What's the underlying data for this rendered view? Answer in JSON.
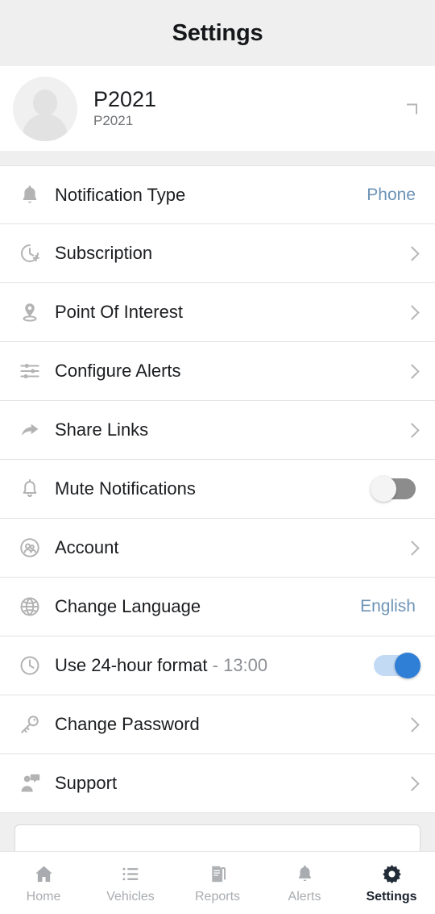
{
  "header": {
    "title": "Settings"
  },
  "profile": {
    "name": "P2021",
    "subtitle": "P2021",
    "avatar_icon": "user-avatar-placeholder-icon",
    "chevron_icon": "chevron-right-icon"
  },
  "colors": {
    "accent_blue": "#6d93b6",
    "toggle_on_knob": "#2f7fd6",
    "toggle_on_track": "#c3daf5",
    "toggle_off_track": "#8c8c8c",
    "header_bg": "#efefef",
    "active_tab": "#1b232e",
    "inactive_tab": "#a8abaf"
  },
  "settings": {
    "rows": [
      {
        "label": "Notification Type",
        "icon": "bell-filled-icon",
        "accessory": "value",
        "value": "Phone"
      },
      {
        "label": "Subscription",
        "icon": "clock-plus-icon",
        "accessory": "chevron"
      },
      {
        "label": "Point Of Interest",
        "icon": "map-pin-icon",
        "accessory": "chevron"
      },
      {
        "label": "Configure Alerts",
        "icon": "sliders-icon",
        "accessory": "chevron"
      },
      {
        "label": "Share Links",
        "icon": "share-arrow-icon",
        "accessory": "chevron"
      },
      {
        "label": "Mute Notifications",
        "icon": "bell-outline-icon",
        "accessory": "toggle",
        "toggle_state": "off"
      },
      {
        "label": "Account",
        "icon": "account-people-icon",
        "accessory": "chevron"
      },
      {
        "label": "Change Language",
        "icon": "globe-icon",
        "accessory": "value",
        "value": "English"
      },
      {
        "label": "Use 24-hour format",
        "suffix": " - 13:00",
        "icon": "clock-icon",
        "accessory": "toggle",
        "toggle_state": "on"
      },
      {
        "label": "Change Password",
        "icon": "key-icon",
        "accessory": "chevron"
      },
      {
        "label": "Support",
        "icon": "support-agent-icon",
        "accessory": "chevron"
      }
    ]
  },
  "tabbar": {
    "items": [
      {
        "label": "Home",
        "icon": "home-icon",
        "active": false
      },
      {
        "label": "Vehicles",
        "icon": "list-icon",
        "active": false
      },
      {
        "label": "Reports",
        "icon": "document-icon",
        "active": false
      },
      {
        "label": "Alerts",
        "icon": "bell-icon",
        "active": false
      },
      {
        "label": "Settings",
        "icon": "gear-icon",
        "active": true
      }
    ]
  }
}
